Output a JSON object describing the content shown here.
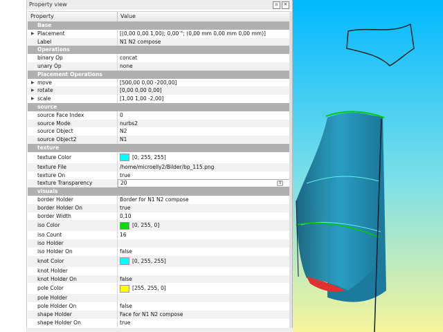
{
  "panel": {
    "title": "Property view",
    "header": {
      "col1": "Property",
      "col2": "Value"
    }
  },
  "rows": [
    {
      "type": "group",
      "label": "Base"
    },
    {
      "type": "prop",
      "key": "Placement",
      "value": "[(0,00 0,00 1,00); 0,00 °; (0,00 mm  0,00 mm  0,00 mm)]",
      "expand": true
    },
    {
      "type": "prop",
      "key": "Label",
      "value": "N1 N2 compose"
    },
    {
      "type": "group",
      "label": "Operations"
    },
    {
      "type": "prop",
      "key": "binary Op",
      "value": "concat"
    },
    {
      "type": "prop",
      "key": "unary Op",
      "value": "none"
    },
    {
      "type": "group",
      "label": "Placement Operations"
    },
    {
      "type": "prop",
      "key": "move",
      "value": "[500,00 0,00 -200,00]",
      "expand": true
    },
    {
      "type": "prop",
      "key": "rotate",
      "value": "[0,00 0,00 0,00]",
      "expand": true
    },
    {
      "type": "prop",
      "key": "scale",
      "value": "[1,00 1,00 -2,00]",
      "expand": true
    },
    {
      "type": "group",
      "label": "source"
    },
    {
      "type": "prop",
      "key": "source Face Index",
      "value": "0"
    },
    {
      "type": "prop",
      "key": "source Mode",
      "value": "nurbs2"
    },
    {
      "type": "prop",
      "key": "source Object",
      "value": "N2"
    },
    {
      "type": "prop",
      "key": "source Object2",
      "value": "N1"
    },
    {
      "type": "group",
      "label": "texture"
    },
    {
      "type": "prop",
      "key": "texture Color",
      "value": "[0, 255, 255]",
      "color": "#00ffff",
      "tall": true
    },
    {
      "type": "prop",
      "key": "texture File",
      "value": "/home/microelly2/Bilder/bp_115.png"
    },
    {
      "type": "prop",
      "key": "texture On",
      "value": "true"
    },
    {
      "type": "prop",
      "key": "texture Transparency",
      "value": "20",
      "spin": true
    },
    {
      "type": "group",
      "label": "visuals"
    },
    {
      "type": "prop",
      "key": "border Holder",
      "value": "Border for N1 N2 compose"
    },
    {
      "type": "prop",
      "key": "border Holder On",
      "value": "true"
    },
    {
      "type": "prop",
      "key": "border Width",
      "value": "0,10"
    },
    {
      "type": "prop",
      "key": "iso Color",
      "value": "[0, 255, 0]",
      "color": "#00dd00",
      "tall": true
    },
    {
      "type": "prop",
      "key": "iso Count",
      "value": "16"
    },
    {
      "type": "prop",
      "key": "iso Holder",
      "value": ""
    },
    {
      "type": "prop",
      "key": "iso Holder On",
      "value": "false"
    },
    {
      "type": "prop",
      "key": "knot Color",
      "value": "[0, 255, 255]",
      "color": "#00ffff",
      "tall": true
    },
    {
      "type": "prop",
      "key": "knot Holder",
      "value": ""
    },
    {
      "type": "prop",
      "key": "knot Holder On",
      "value": "false"
    },
    {
      "type": "prop",
      "key": "pole Color",
      "value": "[255, 255, 0]",
      "color": "#ffff00",
      "tall": true
    },
    {
      "type": "prop",
      "key": "pole Holder",
      "value": ""
    },
    {
      "type": "prop",
      "key": "pole Holder On",
      "value": "false"
    },
    {
      "type": "prop",
      "key": "shape Holder",
      "value": "Face for N1 N2 compose"
    },
    {
      "type": "prop",
      "key": "shape Holder On",
      "value": "true"
    }
  ],
  "colors": {
    "group_bg": "#b0b0b0",
    "viewport_top": "#00bfff",
    "viewport_bottom": "#f5f5a0",
    "surface": "#1e8aa8"
  }
}
